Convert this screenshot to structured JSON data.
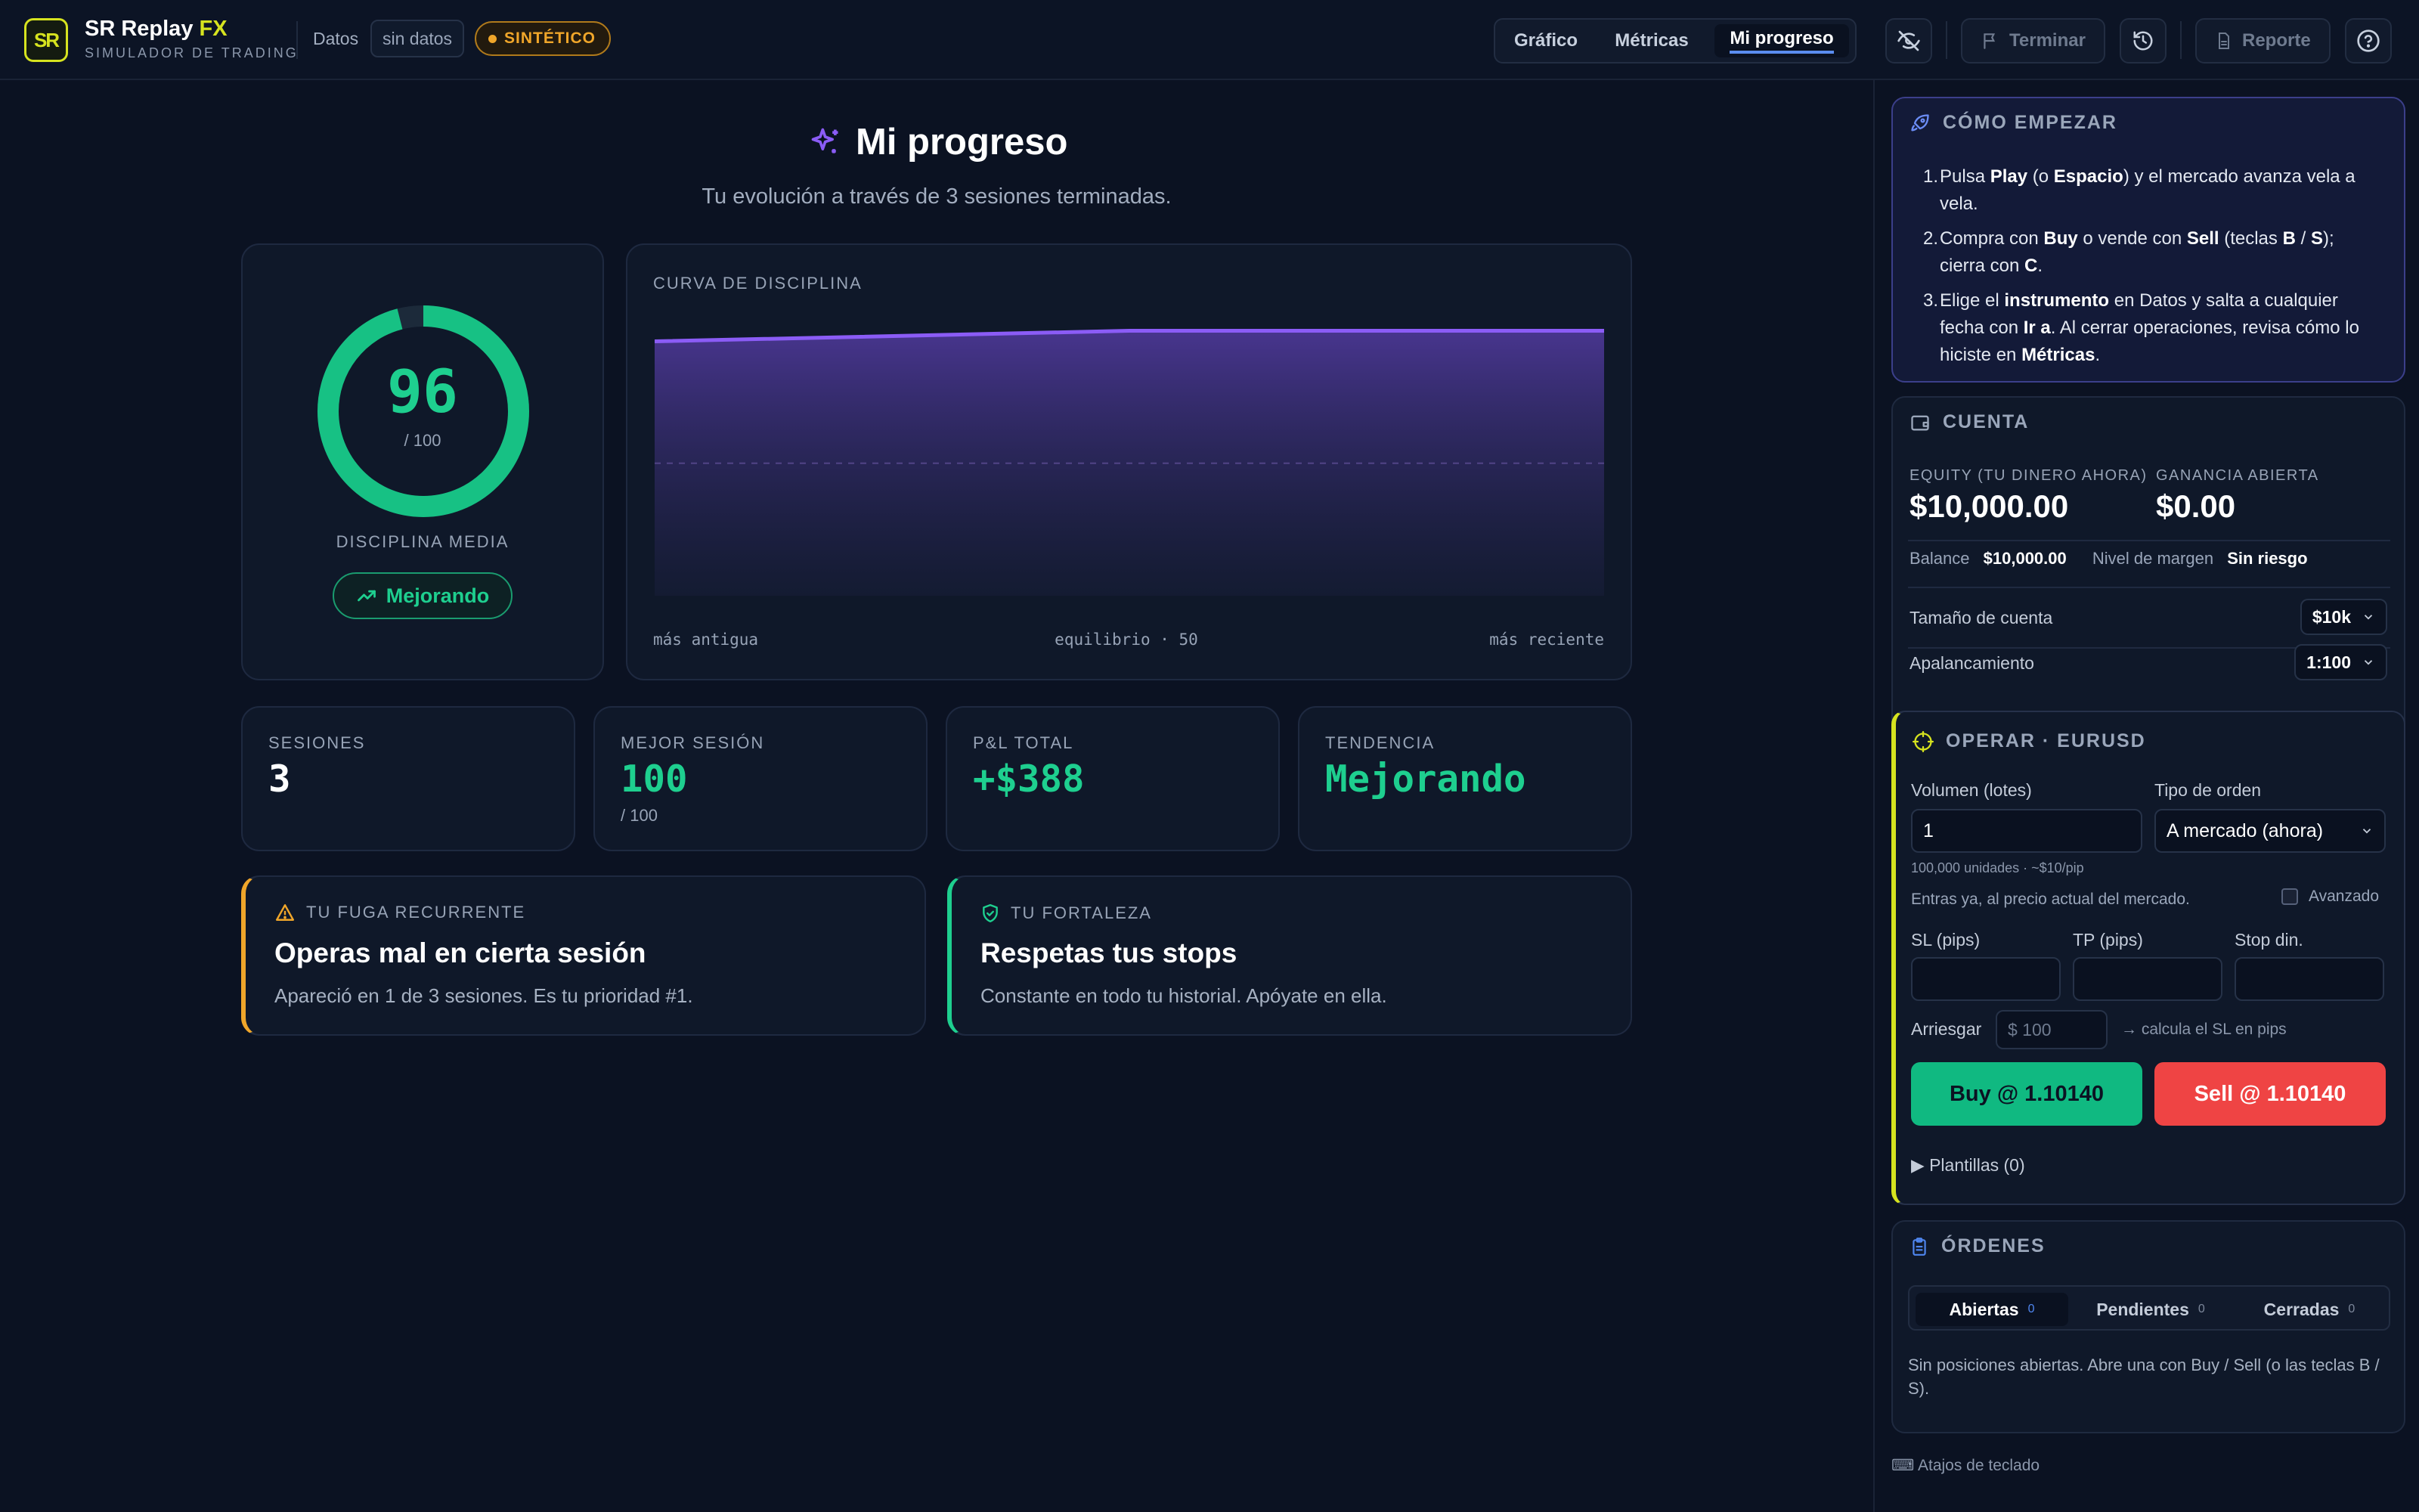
{
  "header": {
    "logo_text": "SR",
    "brand_name": "SR Replay",
    "brand_accent": "FX",
    "brand_subtitle": "SIMULADOR DE TRADING",
    "datos_label": "Datos",
    "datos_value": "sin datos",
    "synthetic_badge": "SINTÉTICO",
    "nav_tabs": [
      "Gráfico",
      "Métricas",
      "Mi progreso"
    ],
    "active_tab": "Mi progreso",
    "hide_button_icon": "eye-off-icon",
    "finish_label": "Terminar",
    "history_icon": "history-icon",
    "report_label": "Reporte",
    "help_icon": "help-circle-icon"
  },
  "progress": {
    "title": "Mi progreso",
    "subtitle": "Tu evolución a través de 3 sesiones terminadas.",
    "discipline_score": "96",
    "discipline_max": "/ 100",
    "discipline_fraction": 0.96,
    "discipline_label": "DISCIPLINA MEDIA",
    "trend_label": "Mejorando",
    "curve_label": "CURVA DE DISCIPLINA",
    "curve_left": "más antigua",
    "curve_mid": "equilibrio · 50",
    "curve_right": "más reciente",
    "curve_values": [
      96,
      100,
      100
    ],
    "curve_equilibrium": 50,
    "stats": [
      {
        "label": "SESIONES",
        "value": "3",
        "sub": ""
      },
      {
        "label": "MEJOR SESIÓN",
        "value": "100",
        "sub": "/ 100"
      },
      {
        "label": "P&L TOTAL",
        "value": "+$388",
        "sub": ""
      },
      {
        "label": "TENDENCIA",
        "value": "Mejorando",
        "sub": ""
      }
    ],
    "leak": {
      "tag": "TU FUGA RECURRENTE",
      "title": "Operas mal en cierta sesión",
      "text": "Apareció en 1 de 3 sesiones. Es tu prioridad #1."
    },
    "strength": {
      "tag": "TU FORTALEZA",
      "title": "Respetas tus stops",
      "text": "Constante en todo tu historial. Apóyate en ella."
    }
  },
  "start": {
    "heading": "CÓMO EMPEZAR",
    "steps": [
      [
        "Pulsa ",
        "Play",
        " (o ",
        "Espacio",
        ") y el mercado avanza vela a vela."
      ],
      [
        "Compra con ",
        "Buy",
        " o vende con ",
        "Sell",
        " (teclas ",
        "B",
        " / ",
        "S",
        "); cierra con ",
        "C",
        "."
      ],
      [
        "Elige el ",
        "instrumento",
        " en Datos y salta a cualquier fecha con ",
        "Ir a",
        ". Al cerrar operaciones, revisa cómo lo hiciste en ",
        "Métricas",
        "."
      ]
    ]
  },
  "account": {
    "heading": "CUENTA",
    "equity_label": "EQUITY (TU DINERO AHORA)",
    "equity_value": "$10,000.00",
    "open_gain_label": "GANANCIA ABIERTA",
    "open_gain_value": "$0.00",
    "balance_label": "Balance",
    "balance_value": "$10,000.00",
    "margin_label": "Nivel de margen",
    "margin_value": "Sin riesgo",
    "size_label": "Tamaño de cuenta",
    "size_value": "$10k",
    "leverage_label": "Apalancamiento",
    "leverage_value": "1:100"
  },
  "trade": {
    "heading": "OPERAR · EURUSD",
    "volume_label": "Volumen (lotes)",
    "volume_value": "1",
    "volume_hint": "100,000 unidades · ~$10/pip",
    "order_type_label": "Tipo de orden",
    "order_type_value": "A mercado (ahora)",
    "order_desc": "Entras ya, al precio actual del mercado.",
    "advanced_label": "Avanzado",
    "sl_label": "SL (pips)",
    "tp_label": "TP (pips)",
    "trail_label": "Stop din.",
    "risk_label": "Arriesgar",
    "risk_placeholder": "$ 100",
    "risk_hint": "→ calcula el SL en pips",
    "buy_label": "Buy @ 1.10140",
    "sell_label": "Sell @ 1.10140",
    "templates_label": "▶ Plantillas (0)"
  },
  "orders": {
    "heading": "ÓRDENES",
    "tabs": [
      {
        "label": "Abiertas",
        "count": "0"
      },
      {
        "label": "Pendientes",
        "count": "0"
      },
      {
        "label": "Cerradas",
        "count": "0"
      }
    ],
    "empty_text": "Sin posiciones abiertas. Abre una con Buy / Sell (o las teclas B / S).",
    "shortcuts_label": "⌨ Atajos de teclado"
  },
  "colors": {
    "background": "#0b1222",
    "accent_green": "#1ecf8f",
    "accent_purple": "#8b5cf6",
    "accent_yellow": "#d6e31f",
    "warning_orange": "#f0a62a",
    "sell_red": "#ef4444",
    "buy_green": "#10b981"
  }
}
